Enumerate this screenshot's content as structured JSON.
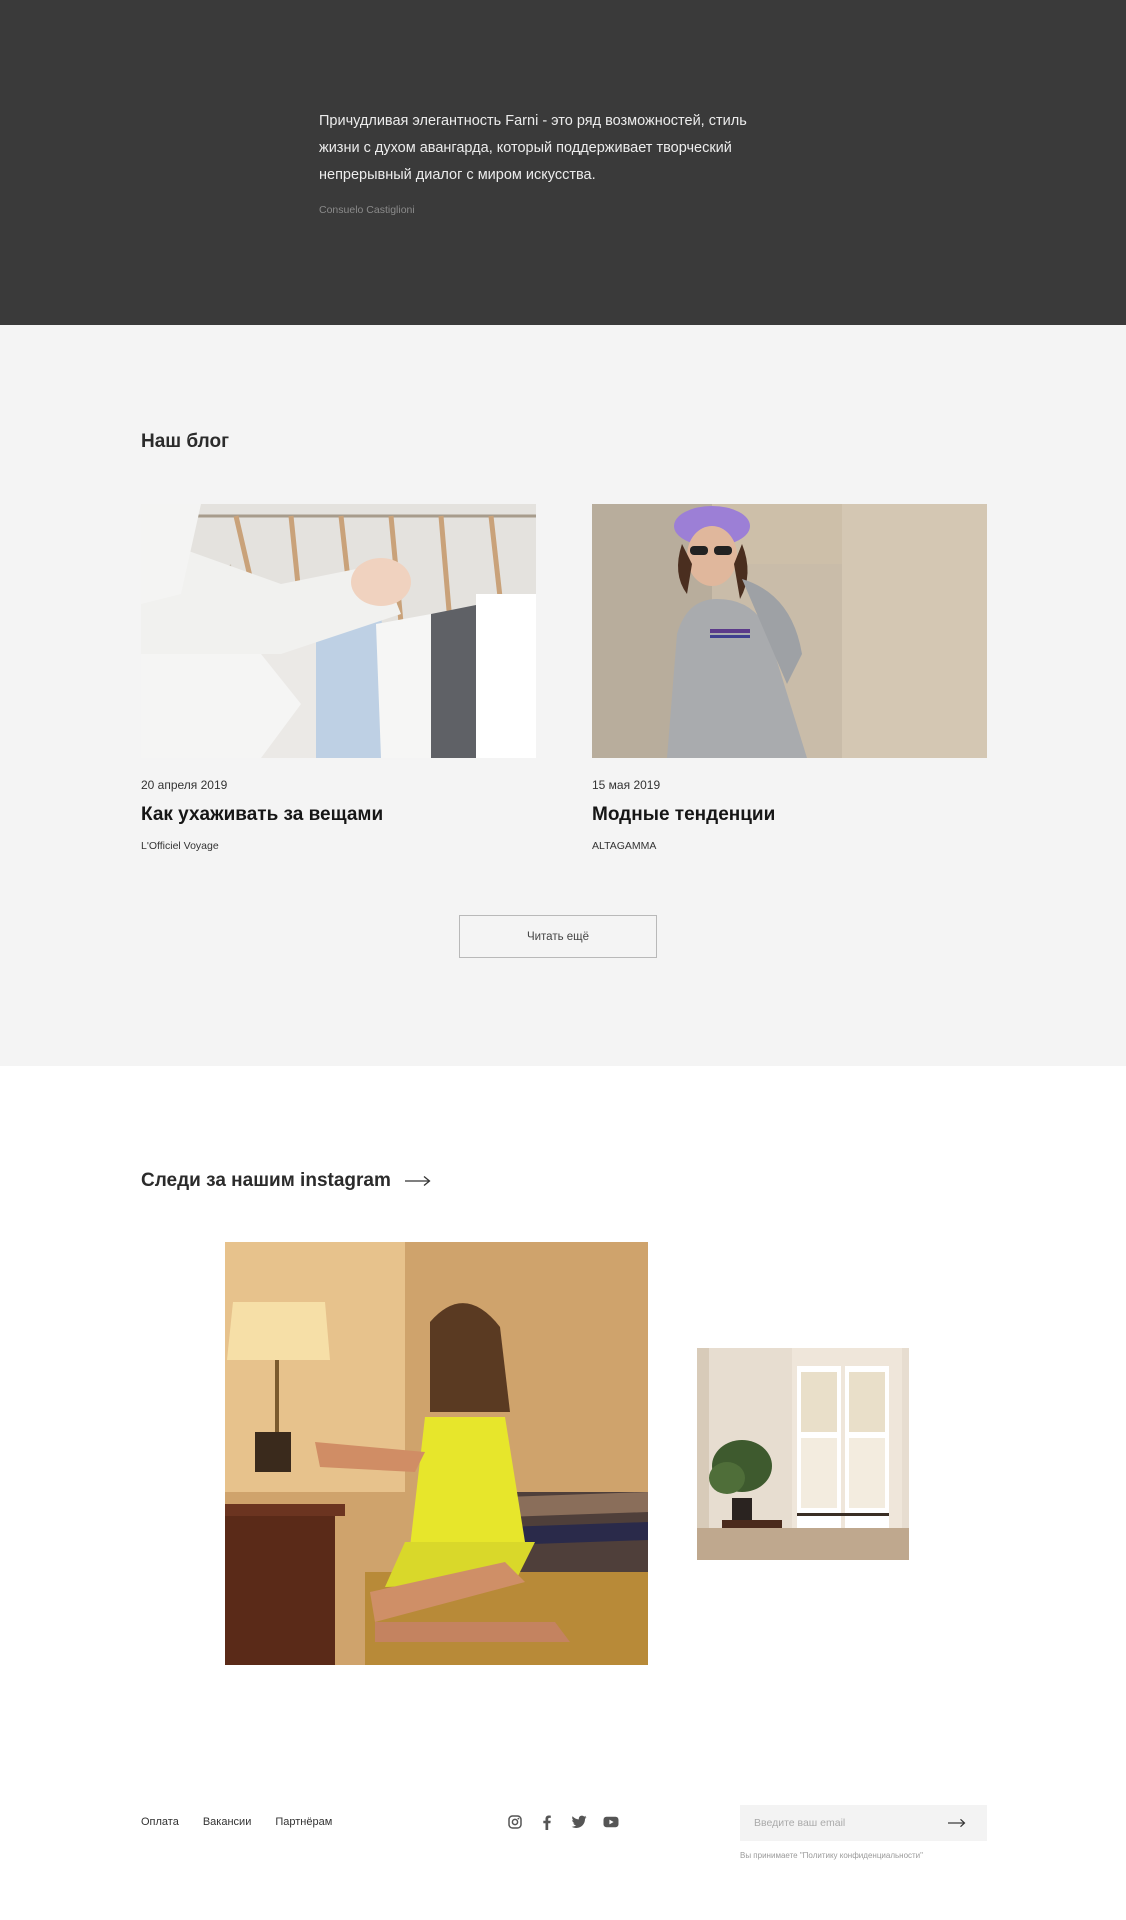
{
  "quote": {
    "text": "Причудливая элегантность Farni - это ряд возможностей, стиль жизни с духом авангарда, который поддерживает творческий непрерывный диалог с миром искусства.",
    "author": "Consuelo Castiglioni"
  },
  "blog": {
    "title": "Наш блог",
    "posts": [
      {
        "date": "20 апреля 2019",
        "title": "Как ухаживать за вещами",
        "source": "L'Officiel Voyage"
      },
      {
        "date": "15 мая 2019",
        "title": "Модные тенденции",
        "source": "ALTAGAMMA"
      }
    ],
    "read_more": "Читать ещё"
  },
  "instagram": {
    "title": "Следи за нашим instagram"
  },
  "footer": {
    "links": [
      "Оплата",
      "Вакансии",
      "Партнёрам"
    ],
    "social_icons": [
      "instagram-icon",
      "facebook-icon",
      "twitter-icon",
      "youtube-icon"
    ],
    "email_placeholder": "Введите ваш email",
    "privacy_note": "Вы принимаете \"Политику конфиденциальности\""
  },
  "colors": {
    "quote_bg": "#3a3a3a",
    "blog_bg": "#f4f4f4",
    "page_bg": "#ffffff",
    "input_bg": "#f3f3f3"
  }
}
